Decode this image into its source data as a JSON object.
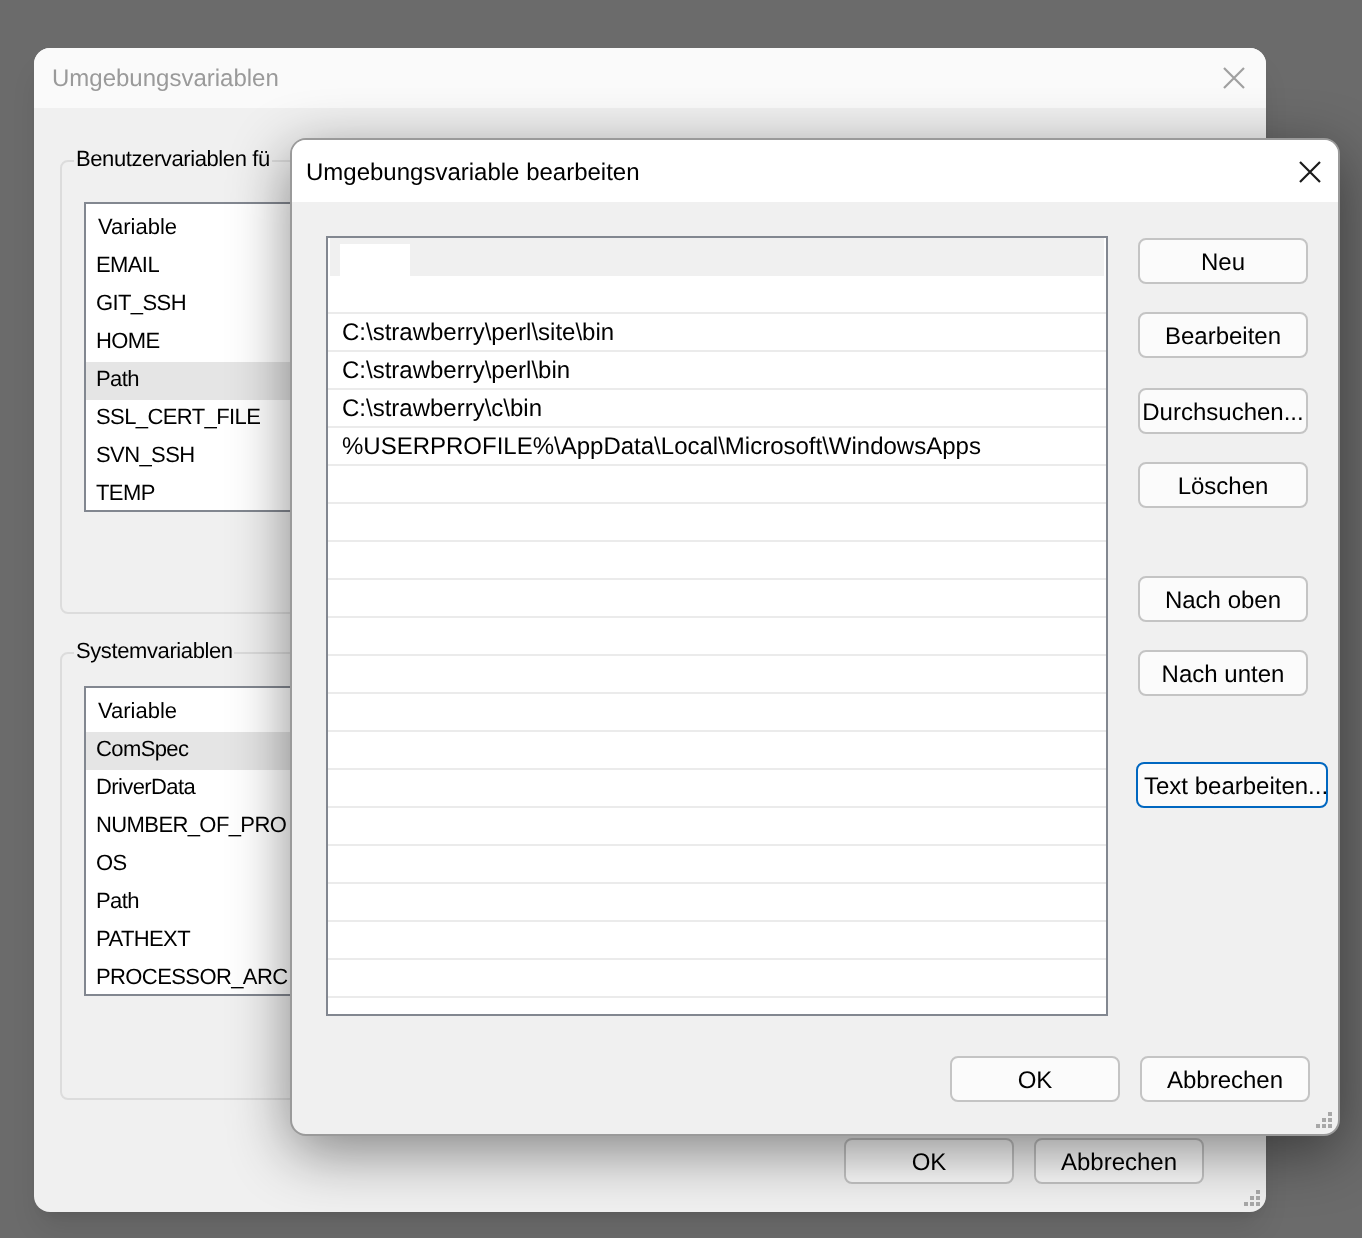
{
  "background_window": {
    "title": "Umgebungsvariablen",
    "active": false,
    "user_variables": {
      "label": "Benutzervariablen fü",
      "column": "Variable",
      "items": [
        {
          "name": "EMAIL",
          "selected": false
        },
        {
          "name": "GIT_SSH",
          "selected": false
        },
        {
          "name": "HOME",
          "selected": false
        },
        {
          "name": "Path",
          "selected": true
        },
        {
          "name": "SSL_CERT_FILE",
          "selected": false
        },
        {
          "name": "SVN_SSH",
          "selected": false
        },
        {
          "name": "TEMP",
          "selected": false
        }
      ]
    },
    "system_variables": {
      "label": "Systemvariablen",
      "column": "Variable",
      "items": [
        {
          "name": "ComSpec",
          "selected": true
        },
        {
          "name": "DriverData",
          "selected": false
        },
        {
          "name": "NUMBER_OF_PRO",
          "selected": false
        },
        {
          "name": "OS",
          "selected": false
        },
        {
          "name": "Path",
          "selected": false
        },
        {
          "name": "PATHEXT",
          "selected": false
        },
        {
          "name": "PROCESSOR_ARC",
          "selected": false
        }
      ]
    },
    "buttons": [
      "OK",
      "Abbrechen"
    ]
  },
  "dialog": {
    "title": "Umgebungsvariable bearbeiten",
    "active": true,
    "entries": [
      {
        "text": "C:\\strawberry\\perl\\site\\bin",
        "selected": false
      },
      {
        "text": "C:\\strawberry\\perl\\bin",
        "selected": false
      },
      {
        "text": "C:\\strawberry\\c\\bin",
        "selected": false
      },
      {
        "text": "%USERPROFILE%\\AppData\\Local\\Microsoft\\WindowsApps",
        "selected": false
      }
    ],
    "side_buttons": [
      {
        "label": "Neu",
        "focused": false
      },
      {
        "label": "Bearbeiten",
        "focused": false
      },
      {
        "label": "Durchsuchen...",
        "focused": false
      },
      {
        "label": "Löschen",
        "focused": false
      },
      {
        "label": "Nach oben",
        "focused": false
      },
      {
        "label": "Nach unten",
        "focused": false
      },
      {
        "label": "Text bearbeiten...",
        "focused": true
      }
    ],
    "buttons": [
      "OK",
      "Abbrechen"
    ]
  }
}
